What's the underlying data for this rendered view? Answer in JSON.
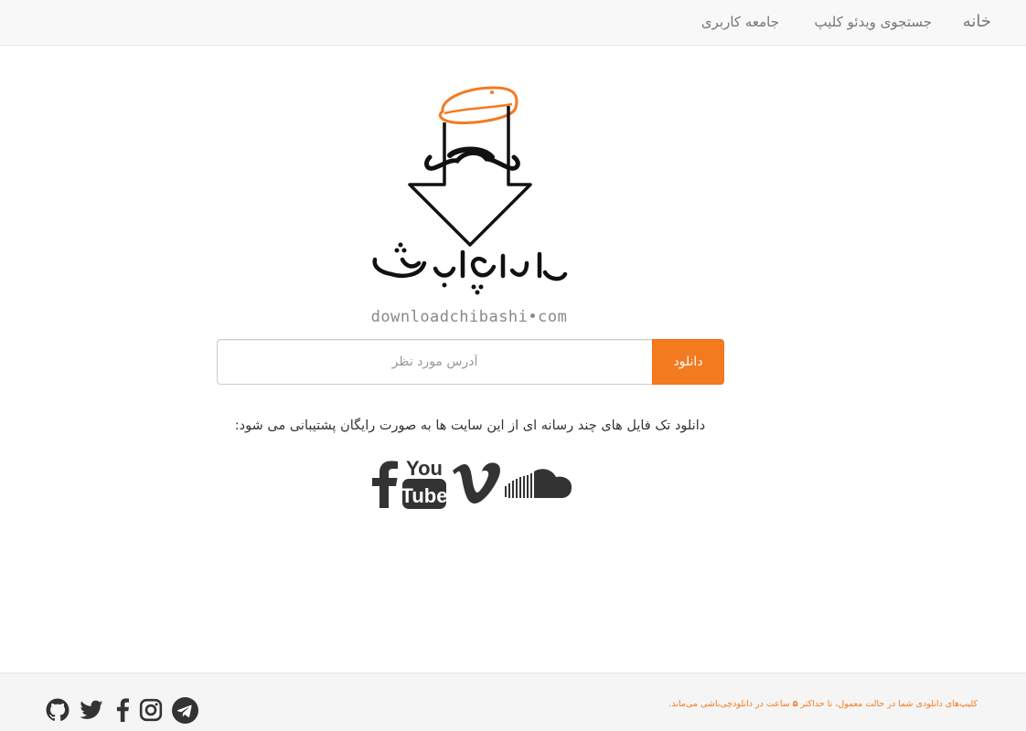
{
  "nav": {
    "brand": "خانه",
    "search_label": "جستجوی ویدئو کلیپ",
    "community_label": "جامعه کاربری"
  },
  "logo": {
    "persian_text": "دانلودچی‌باشی",
    "domain_text": "downloadchibashi•com"
  },
  "form": {
    "placeholder": "آدرس مورد نظر",
    "value": "",
    "button_label": "دانلود"
  },
  "supported_text": "دانلود تک فایل های چند رسانه ای از این سایت ها به صورت رایگان پشتیبانی می شود:",
  "services": [
    "facebook-icon",
    "youtube-icon",
    "vimeo-icon",
    "soundcloud-icon"
  ],
  "footer": {
    "notice_before": "کلیپ‌های دانلودی شما در حالت معمول، تا حداکثر ",
    "notice_hours": "۵",
    "notice_after": " ساعت در دانلودچی‌باشی می‌ماند.",
    "social": [
      "github-icon",
      "twitter-icon",
      "facebook-icon",
      "instagram-icon",
      "telegram-icon"
    ]
  },
  "colors": {
    "accent": "#f47a20",
    "icon_dark": "#333333",
    "nav_text": "#777777"
  }
}
